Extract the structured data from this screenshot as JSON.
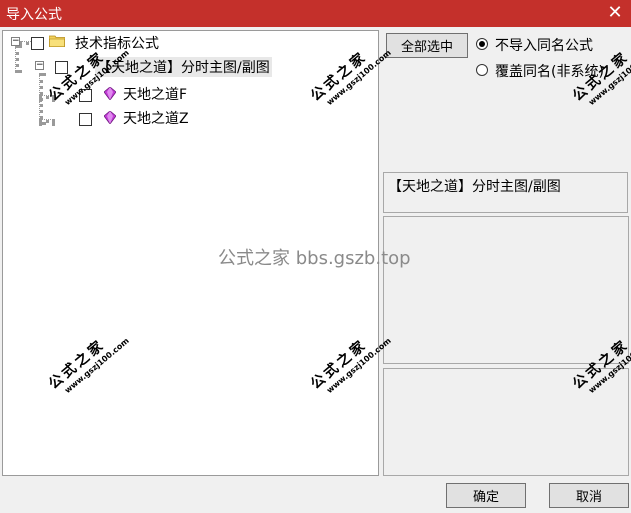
{
  "window": {
    "title": "导入公式"
  },
  "tree": {
    "root": {
      "label": "技术指标公式"
    },
    "group": {
      "label": "【天地之道】分时主图/副图"
    },
    "items": [
      {
        "label": "天地之道F"
      },
      {
        "label": "天地之道Z"
      }
    ]
  },
  "options": {
    "select_all_label": "全部选中",
    "radios": [
      {
        "label": "不导入同名公式",
        "checked": true
      },
      {
        "label": "覆盖同名(非系统)",
        "checked": false
      }
    ]
  },
  "info": {
    "text": "【天地之道】分时主图/副图"
  },
  "footer": {
    "ok_label": "确定",
    "cancel_label": "取消"
  },
  "watermark": {
    "text": "公式之家",
    "url": "www.gszj100.com",
    "center_text": "公式之家 bbs.gszb.top"
  }
}
